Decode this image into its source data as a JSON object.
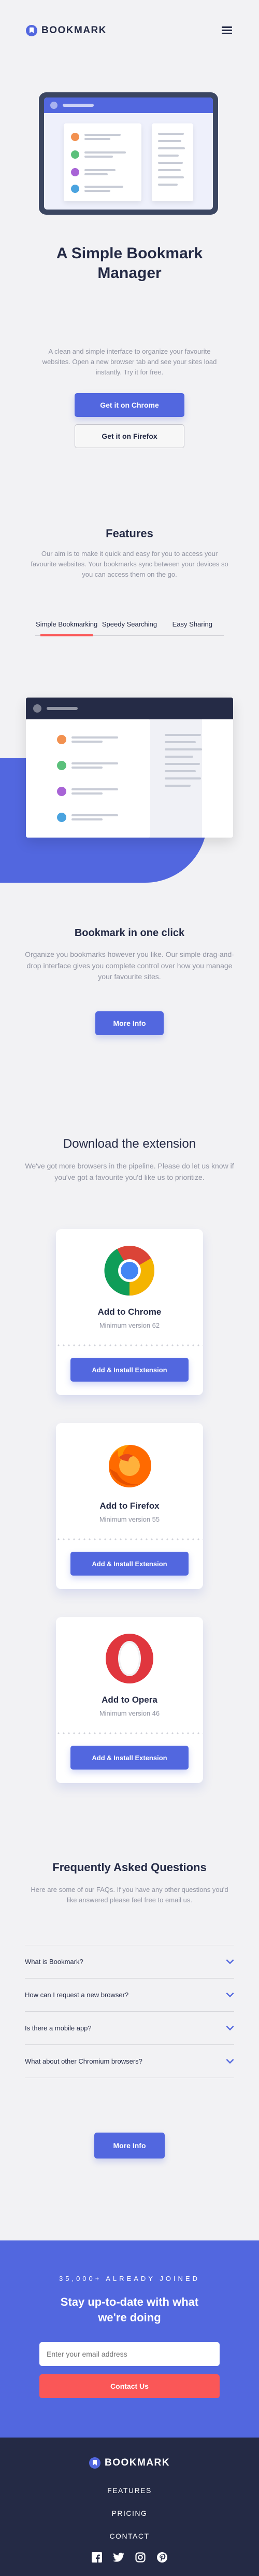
{
  "brand": {
    "name": "BOOKMARK",
    "accent": "#5267df",
    "red": "#fa5757",
    "navy": "#242a45"
  },
  "hero": {
    "title_line1": "A Simple Bookmark",
    "title_line2": "Manager",
    "description": "A clean and simple interface to organize your favourite websites. Open a new browser tab and see your sites load instantly. Try it for free.",
    "cta_chrome": "Get it on Chrome",
    "cta_firefox": "Get it on Firefox"
  },
  "features": {
    "title": "Features",
    "description": "Our aim is to make it quick and easy for you to access your favourite websites. Your bookmarks sync between your devices so you can access them on the go.",
    "tabs": [
      {
        "label": "Simple Bookmarking",
        "active": true
      },
      {
        "label": "Speedy Searching",
        "active": false
      },
      {
        "label": "Easy Sharing",
        "active": false
      }
    ],
    "panel_title": "Bookmark in one click",
    "panel_text": "Organize you bookmarks however you like. Our simple drag-and-drop interface gives you complete control over how you manage your favourite sites.",
    "panel_button": "More Info"
  },
  "download": {
    "title": "Download the extension",
    "description": "We've got more browsers in the pipeline. Please do let us know if you've got a favourite you'd like us to prioritize.",
    "cards": [
      {
        "icon": "chrome-icon",
        "title": "Add to Chrome",
        "version": "Minimum version 62",
        "button": "Add & Install Extension"
      },
      {
        "icon": "firefox-icon",
        "title": "Add to Firefox",
        "version": "Minimum version 55",
        "button": "Add & Install Extension"
      },
      {
        "icon": "opera-icon",
        "title": "Add to Opera",
        "version": "Minimum version 46",
        "button": "Add & Install Extension"
      }
    ]
  },
  "faq": {
    "title": "Frequently Asked Questions",
    "description": "Here are some of our FAQs. If you have any other questions you'd like answered please feel free to email us.",
    "items": [
      "What is Bookmark?",
      "How can I request a new browser?",
      "Is there a mobile app?",
      "What about other Chromium browsers?"
    ],
    "button": "More Info"
  },
  "newsletter": {
    "eyebrow": "35,000+ ALREADY JOINED",
    "title_line1": "Stay up-to-date with what",
    "title_line2": "we're doing",
    "placeholder": "Enter your email address",
    "button": "Contact Us"
  },
  "footer": {
    "brand": "BOOKMARK",
    "links": [
      "FEATURES",
      "PRICING",
      "CONTACT"
    ],
    "socials": [
      "facebook-icon",
      "twitter-icon",
      "instagram-icon",
      "pinterest-icon"
    ]
  }
}
